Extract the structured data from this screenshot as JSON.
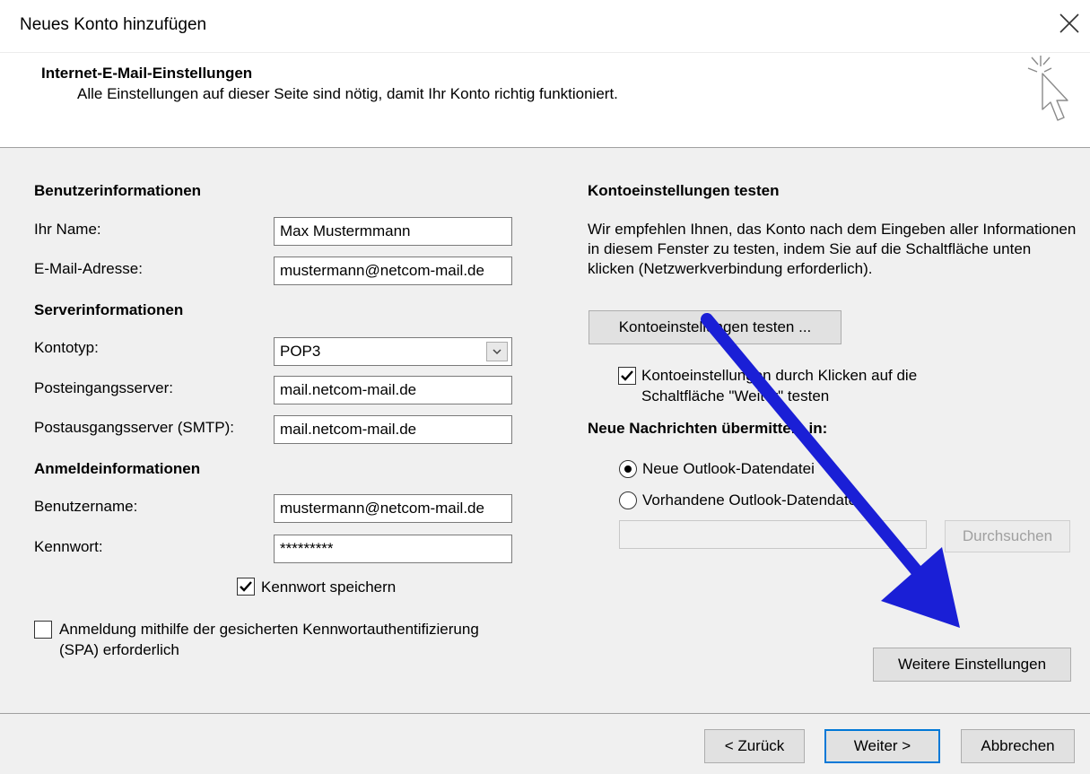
{
  "window": {
    "title": "Neues Konto hinzufügen"
  },
  "header": {
    "title": "Internet-E-Mail-Einstellungen",
    "subtitle": "Alle Einstellungen auf dieser Seite sind nötig, damit Ihr Konto richtig funktioniert."
  },
  "user": {
    "heading": "Benutzerinformationen",
    "name_label": "Ihr Name:",
    "name_value": "Max Mustermmann",
    "email_label": "E-Mail-Adresse:",
    "email_value": "mustermann@netcom-mail.de"
  },
  "server": {
    "heading": "Serverinformationen",
    "account_type_label": "Kontotyp:",
    "account_type_value": "POP3",
    "incoming_label": "Posteingangsserver:",
    "incoming_value": "mail.netcom-mail.de",
    "outgoing_label": "Postausgangsserver (SMTP):",
    "outgoing_value": "mail.netcom-mail.de"
  },
  "login": {
    "heading": "Anmeldeinformationen",
    "username_label": "Benutzername:",
    "username_value": "mustermann@netcom-mail.de",
    "password_label": "Kennwort:",
    "password_value": "*********",
    "save_password_label": "Kennwort speichern",
    "save_password_checked": true,
    "spa_label_line1": "Anmeldung mithilfe der gesicherten Kennwortauthentifizierung",
    "spa_label_line2": "(SPA) erforderlich",
    "spa_checked": false
  },
  "test": {
    "heading": "Kontoeinstellungen testen",
    "description": "Wir empfehlen Ihnen, das Konto nach dem Eingeben aller Informationen in diesem Fenster zu testen, indem Sie auf die Schaltfläche unten klicken (Netzwerkverbindung erforderlich).",
    "button_label": "Kontoeinstellungen testen ...",
    "auto_test_line1": "Kontoeinstellungen durch Klicken auf die",
    "auto_test_line2": "Schaltfläche \"Weiter\" testen",
    "auto_test_checked": true
  },
  "deliver": {
    "heading": "Neue Nachrichten übermitteln in:",
    "option_new": "Neue Outlook-Datendatei",
    "option_existing": "Vorhandene Outlook-Datendatei",
    "selected": "new",
    "path_value": "",
    "browse_label": "Durchsuchen"
  },
  "more_settings_label": "Weitere Einstellungen",
  "footer": {
    "back_label": "< Zurück",
    "next_label": "Weiter >",
    "cancel_label": "Abbrechen"
  },
  "colors": {
    "arrow": "#1a1fd6",
    "accent": "#0078d7"
  }
}
